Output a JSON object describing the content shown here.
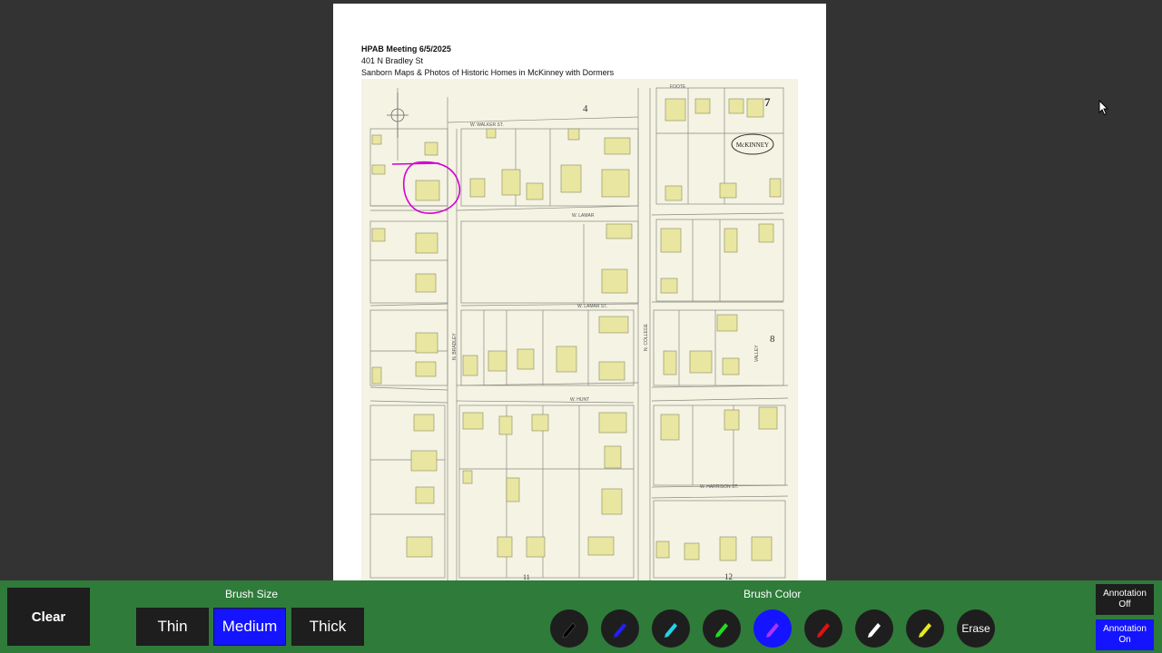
{
  "document": {
    "title": "HPAB Meeting 6/5/2025",
    "address": "401 N Bradley St",
    "subtitle": "Sanborn Maps & Photos of Historic Homes in McKinney with Dormers"
  },
  "map": {
    "sheet_numbers": [
      "4",
      "7",
      "8",
      "11",
      "12"
    ],
    "street_labels": [
      "W. WALKER ST.",
      "W. LAMAR",
      "W. LAMAR ST.",
      "W. HUNT",
      "N. BRADLEY",
      "N. COLLEGE",
      "W. HARRISON ST.",
      "VALLEY",
      "FOOTE"
    ],
    "seal_text": "McKINNEY",
    "annotation_color": "#d400d4"
  },
  "toolbar": {
    "clear_label": "Clear",
    "brush_size_label": "Brush Size",
    "thin_label": "Thin",
    "medium_label": "Medium",
    "thick_label": "Thick",
    "brush_color_label": "Brush Color",
    "erase_label": "Erase",
    "annotation_off_line1": "Annotation",
    "annotation_off_line2": "Off",
    "annotation_on_line1": "Annotation",
    "annotation_on_line2": "On",
    "selected_size": "Medium",
    "selected_color": "purple",
    "colors": [
      {
        "name": "black",
        "hex": "#000000"
      },
      {
        "name": "blue",
        "hex": "#2020ff"
      },
      {
        "name": "cyan",
        "hex": "#22d3e6"
      },
      {
        "name": "green",
        "hex": "#22dd22"
      },
      {
        "name": "purple",
        "hex": "#aa33ff"
      },
      {
        "name": "red",
        "hex": "#dd1111"
      },
      {
        "name": "white",
        "hex": "#ffffff"
      },
      {
        "name": "yellow",
        "hex": "#e8e820"
      }
    ]
  }
}
